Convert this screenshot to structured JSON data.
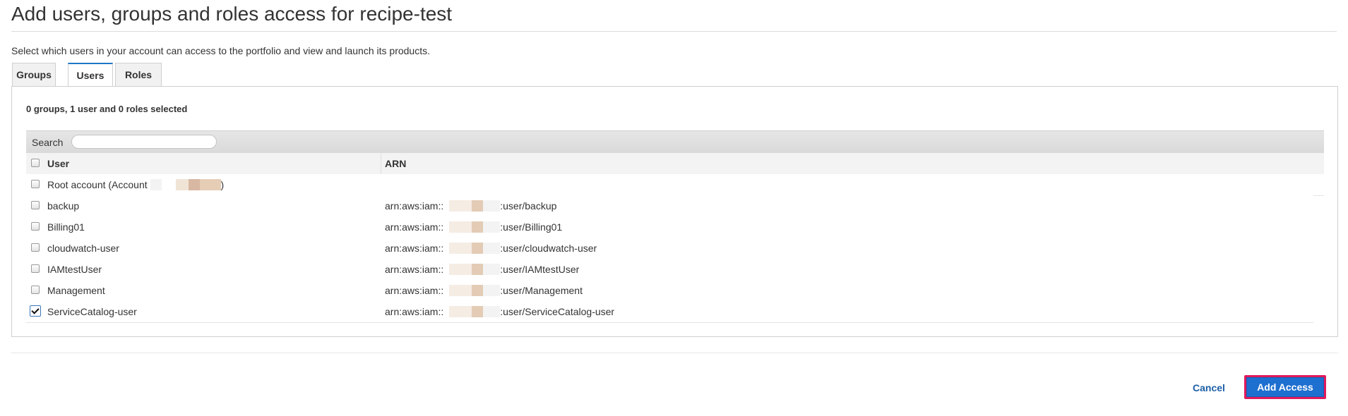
{
  "page": {
    "title": "Add users, groups and roles access for recipe-test",
    "description": "Select which users in your account can access to the portfolio and view and launch its products."
  },
  "tabs": [
    {
      "label": "Groups",
      "active": false
    },
    {
      "label": "Users",
      "active": true
    },
    {
      "label": "Roles",
      "active": false
    }
  ],
  "selection_summary": "0 groups, 1 user and 0 roles selected",
  "search": {
    "label": "Search",
    "value": ""
  },
  "table": {
    "columns": [
      "User",
      "ARN"
    ],
    "rows": [
      {
        "user_prefix": "Root account (Account ",
        "user_suffix": ")",
        "arn_prefix": "",
        "arn_suffix": "",
        "checked": false
      },
      {
        "user": "backup",
        "arn_prefix": "arn:aws:iam::",
        "arn_suffix": ":user/backup",
        "checked": false
      },
      {
        "user": "Billing01",
        "arn_prefix": "arn:aws:iam::",
        "arn_suffix": ":user/Billing01",
        "checked": false
      },
      {
        "user": "cloudwatch-user",
        "arn_prefix": "arn:aws:iam::",
        "arn_suffix": ":user/cloudwatch-user",
        "checked": false
      },
      {
        "user": "IAMtestUser",
        "arn_prefix": "arn:aws:iam::",
        "arn_suffix": ":user/IAMtestUser",
        "checked": false
      },
      {
        "user": "Management",
        "arn_prefix": "arn:aws:iam::",
        "arn_suffix": ":user/Management",
        "checked": false
      },
      {
        "user": "ServiceCatalog-user",
        "arn_prefix": "arn:aws:iam::",
        "arn_suffix": ":user/ServiceCatalog-user",
        "checked": true
      }
    ]
  },
  "footer": {
    "cancel_label": "Cancel",
    "add_access_label": "Add Access"
  },
  "colors": {
    "primary_button": "#1d6fd0",
    "highlight_border": "#e0195d",
    "link": "#1d5fa6",
    "active_tab_accent": "#1f76c7"
  }
}
